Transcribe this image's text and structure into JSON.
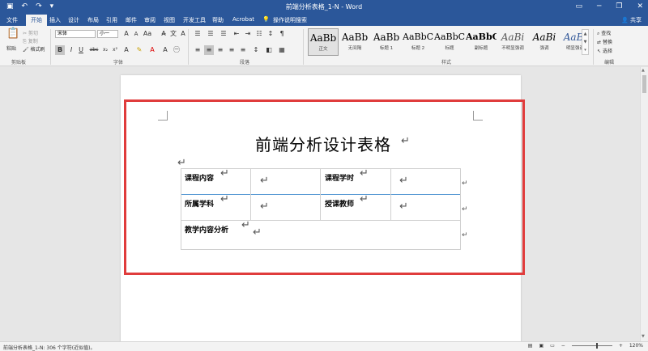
{
  "titlebar": {
    "title": "前端分析表格_1-N  -  Word",
    "save_icon": "save-icon",
    "undo_icon": "undo-icon",
    "redo_icon": "redo-icon"
  },
  "tabs": [
    {
      "label": "文件"
    },
    {
      "label": "开始"
    },
    {
      "label": "插入"
    },
    {
      "label": "设计"
    },
    {
      "label": "布局"
    },
    {
      "label": "引用"
    },
    {
      "label": "邮件"
    },
    {
      "label": "审阅"
    },
    {
      "label": "视图"
    },
    {
      "label": "开发工具"
    },
    {
      "label": "帮助"
    },
    {
      "label": "Acrobat"
    },
    {
      "label": "操作说明搜索"
    }
  ],
  "share_label": "共享",
  "ribbon": {
    "clipboard": {
      "paste": "粘贴",
      "cut": "剪切",
      "copy": "复制",
      "format_painter": "格式刷",
      "group_label": "剪贴板"
    },
    "font": {
      "font_name": "宋体",
      "font_size": "小一",
      "group_label": "字体"
    },
    "paragraph": {
      "group_label": "段落"
    },
    "styles": {
      "group_label": "样式",
      "items": [
        {
          "sample": "AaBb",
          "name": "正文"
        },
        {
          "sample": "AaBb",
          "name": "无间隔"
        },
        {
          "sample": "AaBb",
          "name": "标题 1"
        },
        {
          "sample": "AaBbC",
          "name": "标题 2"
        },
        {
          "sample": "AaBbC",
          "name": "标题"
        },
        {
          "sample": "AaBbC",
          "name": "副标题"
        },
        {
          "sample": "AaBi",
          "name": "不明显强调"
        },
        {
          "sample": "AaBi",
          "name": "强调"
        },
        {
          "sample": "AaBi",
          "name": "明显强调"
        }
      ]
    },
    "editing": {
      "find": "查找",
      "replace": "替换",
      "select": "选择",
      "group_label": "编辑"
    }
  },
  "document": {
    "title": "前端分析设计表格",
    "table": {
      "row1": {
        "c1": "课程内容",
        "c3": "课程学时"
      },
      "row2": {
        "c1": "所属学科",
        "c3": "授课教师"
      },
      "row3": {
        "c1": "教学内容分析"
      }
    }
  },
  "statusbar": {
    "word_count": "前端分析表格_1-N: 306 个字符(近似值)。",
    "zoom": "120%"
  }
}
